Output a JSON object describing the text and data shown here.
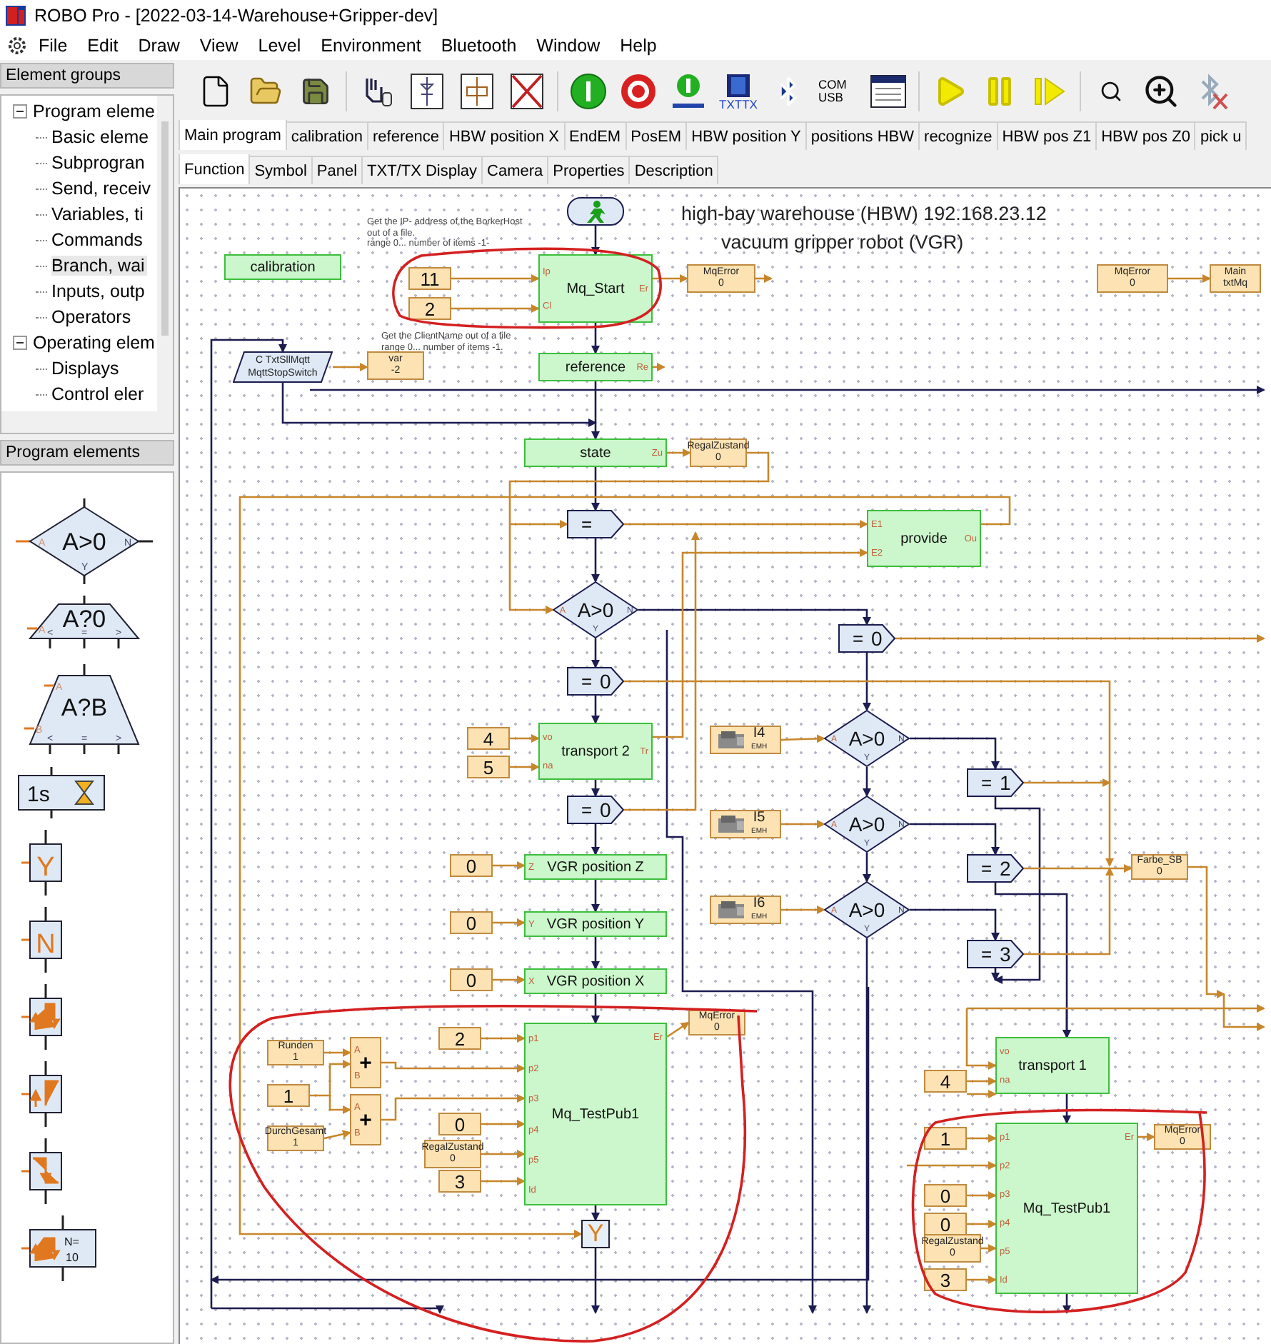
{
  "window": {
    "title": "ROBO Pro - [2022-03-14-Warehouse+Gripper-dev]"
  },
  "menu": [
    "File",
    "Edit",
    "Draw",
    "View",
    "Level",
    "Environment",
    "Bluetooth",
    "Window",
    "Help"
  ],
  "toolbar": {
    "interface_label": "TXTTX",
    "port_labels": [
      "COM",
      "USB"
    ]
  },
  "element_groups": {
    "title": "Element groups",
    "tree": [
      {
        "label": "Program eleme",
        "expanded": true,
        "children": [
          {
            "label": "Basic eleme",
            "selected": false
          },
          {
            "label": "Subprogran",
            "selected": false
          },
          {
            "label": "Send, receiv",
            "selected": false
          },
          {
            "label": "Variables, ti",
            "selected": false
          },
          {
            "label": "Commands",
            "selected": false
          },
          {
            "label": "Branch, wai",
            "selected": true
          },
          {
            "label": "Inputs, outp",
            "selected": false
          },
          {
            "label": "Operators",
            "selected": false
          }
        ]
      },
      {
        "label": "Operating elem",
        "expanded": true,
        "children": [
          {
            "label": "Displays",
            "selected": false
          },
          {
            "label": "Control eler",
            "selected": false
          }
        ]
      }
    ]
  },
  "program_elements": {
    "title": "Program elements",
    "items": [
      {
        "kind": "compare-zero",
        "labels": [
          "A>0"
        ],
        "ports": [
          "A",
          "N",
          "Y"
        ]
      },
      {
        "kind": "compare-value",
        "labels": [
          "A?0"
        ],
        "ports": [
          "A",
          "<",
          "=",
          ">"
        ]
      },
      {
        "kind": "compare-two",
        "labels": [
          "A?B"
        ],
        "ports": [
          "A",
          "B",
          "<",
          "=",
          ">"
        ]
      },
      {
        "kind": "timer",
        "labels": [
          "1s"
        ]
      },
      {
        "kind": "flag",
        "labels": [
          "Y"
        ]
      },
      {
        "kind": "flag",
        "labels": [
          "N"
        ]
      },
      {
        "kind": "edge-both"
      },
      {
        "kind": "edge-rise"
      },
      {
        "kind": "edge-fall"
      },
      {
        "kind": "counter",
        "labels": [
          "N=",
          "10"
        ]
      }
    ]
  },
  "program_tabs": [
    {
      "label": "Main program",
      "selected": true
    },
    {
      "label": "calibration",
      "selected": false
    },
    {
      "label": "reference",
      "selected": false
    },
    {
      "label": "HBW position X",
      "selected": false
    },
    {
      "label": "EndEM",
      "selected": false
    },
    {
      "label": "PosEM",
      "selected": false
    },
    {
      "label": "HBW position Y",
      "selected": false
    },
    {
      "label": "positions HBW",
      "selected": false
    },
    {
      "label": "recognize",
      "selected": false
    },
    {
      "label": "HBW pos Z1",
      "selected": false
    },
    {
      "label": "HBW pos Z0",
      "selected": false
    },
    {
      "label": "pick u",
      "selected": false
    }
  ],
  "view_tabs": [
    {
      "label": "Function",
      "selected": true
    },
    {
      "label": "Symbol",
      "selected": false
    },
    {
      "label": "Panel",
      "selected": false
    },
    {
      "label": "TXT/TX Display",
      "selected": false
    },
    {
      "label": "Camera",
      "selected": false
    },
    {
      "label": "Properties",
      "selected": false
    },
    {
      "label": "Description",
      "selected": false
    }
  ],
  "canvas": {
    "titles": [
      "high-bay warehouse (HBW) 192.168.23.12",
      "vacuum gripper robot (VGR)"
    ],
    "comments": [
      [
        "Get the IP- address of the BorkerHost",
        "out of a file.",
        "range 0... number of items -1-"
      ],
      [
        "Get the  ClientName out of a file",
        "range 0... number of items -1."
      ]
    ],
    "nodes": [
      {
        "kind": "start"
      },
      {
        "kind": "subprogram",
        "label": "calibration"
      },
      {
        "kind": "constant",
        "label": "11"
      },
      {
        "kind": "constant",
        "label": "2"
      },
      {
        "kind": "subprogram",
        "label": "Mq_Start",
        "left": [
          "Ip",
          "Cl"
        ],
        "right": [
          "Er"
        ]
      },
      {
        "kind": "variable",
        "label": "MqError",
        "value": "0"
      },
      {
        "kind": "variable",
        "label": "MqError",
        "value": "0"
      },
      {
        "kind": "variable",
        "label": "Main",
        "value": "txtMq"
      },
      {
        "kind": "input",
        "lines": [
          "C TxtSllMqtt",
          "MqttStopSwitch"
        ]
      },
      {
        "kind": "variable",
        "label": "var",
        "value": "-2"
      },
      {
        "kind": "subprogram",
        "label": "reference",
        "right": [
          "Re"
        ]
      },
      {
        "kind": "subprogram",
        "label": "state",
        "right": [
          "Zu"
        ]
      },
      {
        "kind": "variable",
        "label": "RegalZustand",
        "value": "0"
      },
      {
        "kind": "branch",
        "label": "="
      },
      {
        "kind": "subprogram",
        "label": "provide",
        "left": [
          "E1",
          "E2"
        ],
        "right": [
          "Ou"
        ]
      },
      {
        "kind": "diamond",
        "label": "A>0",
        "ports": [
          "A",
          "N",
          "Y"
        ]
      },
      {
        "kind": "branch",
        "label": "=",
        "value": "0"
      },
      {
        "kind": "branch",
        "label": "=",
        "value": "0"
      },
      {
        "kind": "constant",
        "label": "4"
      },
      {
        "kind": "constant",
        "label": "5"
      },
      {
        "kind": "subprogram",
        "label": "transport 2",
        "left": [
          "vo",
          "na"
        ],
        "right": [
          "Tr"
        ]
      },
      {
        "kind": "branch",
        "label": "=",
        "value": "0"
      },
      {
        "kind": "constant",
        "label": "0"
      },
      {
        "kind": "subprogram",
        "label": "VGR position Z",
        "left": [
          "Z"
        ]
      },
      {
        "kind": "constant",
        "label": "0"
      },
      {
        "kind": "subprogram",
        "label": "VGR position Y",
        "left": [
          "Y"
        ]
      },
      {
        "kind": "constant",
        "label": "0"
      },
      {
        "kind": "subprogram",
        "label": "VGR position X",
        "left": [
          "X"
        ]
      },
      {
        "kind": "sensor",
        "label": "I4",
        "value": "EMH"
      },
      {
        "kind": "diamond",
        "label": "A>0",
        "ports": [
          "A",
          "N",
          "Y"
        ]
      },
      {
        "kind": "sensor",
        "label": "I5",
        "value": "EMH"
      },
      {
        "kind": "diamond",
        "label": "A>0",
        "ports": [
          "A",
          "N",
          "Y"
        ]
      },
      {
        "kind": "sensor",
        "label": "I6",
        "value": "EMH"
      },
      {
        "kind": "diamond",
        "label": "A>0",
        "ports": [
          "A",
          "N",
          "Y"
        ]
      },
      {
        "kind": "branch",
        "label": "=",
        "value": "1"
      },
      {
        "kind": "branch",
        "label": "=",
        "value": "2"
      },
      {
        "kind": "branch",
        "label": "=",
        "value": "3"
      },
      {
        "kind": "variable",
        "label": "Farbe_SB",
        "value": "0"
      },
      {
        "kind": "variable",
        "label": "Runden",
        "value": "1"
      },
      {
        "kind": "constant",
        "label": "1"
      },
      {
        "kind": "variable",
        "label": "DurchGesamt",
        "value": "1"
      },
      {
        "kind": "operator",
        "label": "+",
        "left": [
          "A",
          "B"
        ]
      },
      {
        "kind": "operator",
        "label": "+",
        "left": [
          "A",
          "B"
        ]
      },
      {
        "kind": "constant",
        "label": "2"
      },
      {
        "kind": "constant",
        "label": "0"
      },
      {
        "kind": "variable",
        "label": "RegalZustand",
        "value": "0"
      },
      {
        "kind": "constant",
        "label": "3"
      },
      {
        "kind": "subprogram",
        "label": "Mq_TestPub1",
        "left": [
          "p1",
          "p2",
          "p3",
          "p4",
          "p5",
          "Id"
        ],
        "right": [
          "Er"
        ]
      },
      {
        "kind": "variable",
        "label": "MqError",
        "value": "0"
      },
      {
        "kind": "flag",
        "label": "Y"
      },
      {
        "kind": "subprogram",
        "label": "transport 1",
        "left": [
          "vo",
          "na"
        ]
      },
      {
        "kind": "constant",
        "label": "4"
      },
      {
        "kind": "constant",
        "label": "1"
      },
      {
        "kind": "constant",
        "label": "0"
      },
      {
        "kind": "constant",
        "label": "0"
      },
      {
        "kind": "variable",
        "label": "RegalZustand",
        "value": "0"
      },
      {
        "kind": "constant",
        "label": "3"
      },
      {
        "kind": "subprogram",
        "label": "Mq_TestPub1",
        "left": [
          "p1",
          "p2",
          "p3",
          "p4",
          "p5",
          "Id"
        ],
        "right": [
          "Er"
        ]
      },
      {
        "kind": "variable",
        "label": "MqError",
        "value": "0"
      }
    ]
  }
}
